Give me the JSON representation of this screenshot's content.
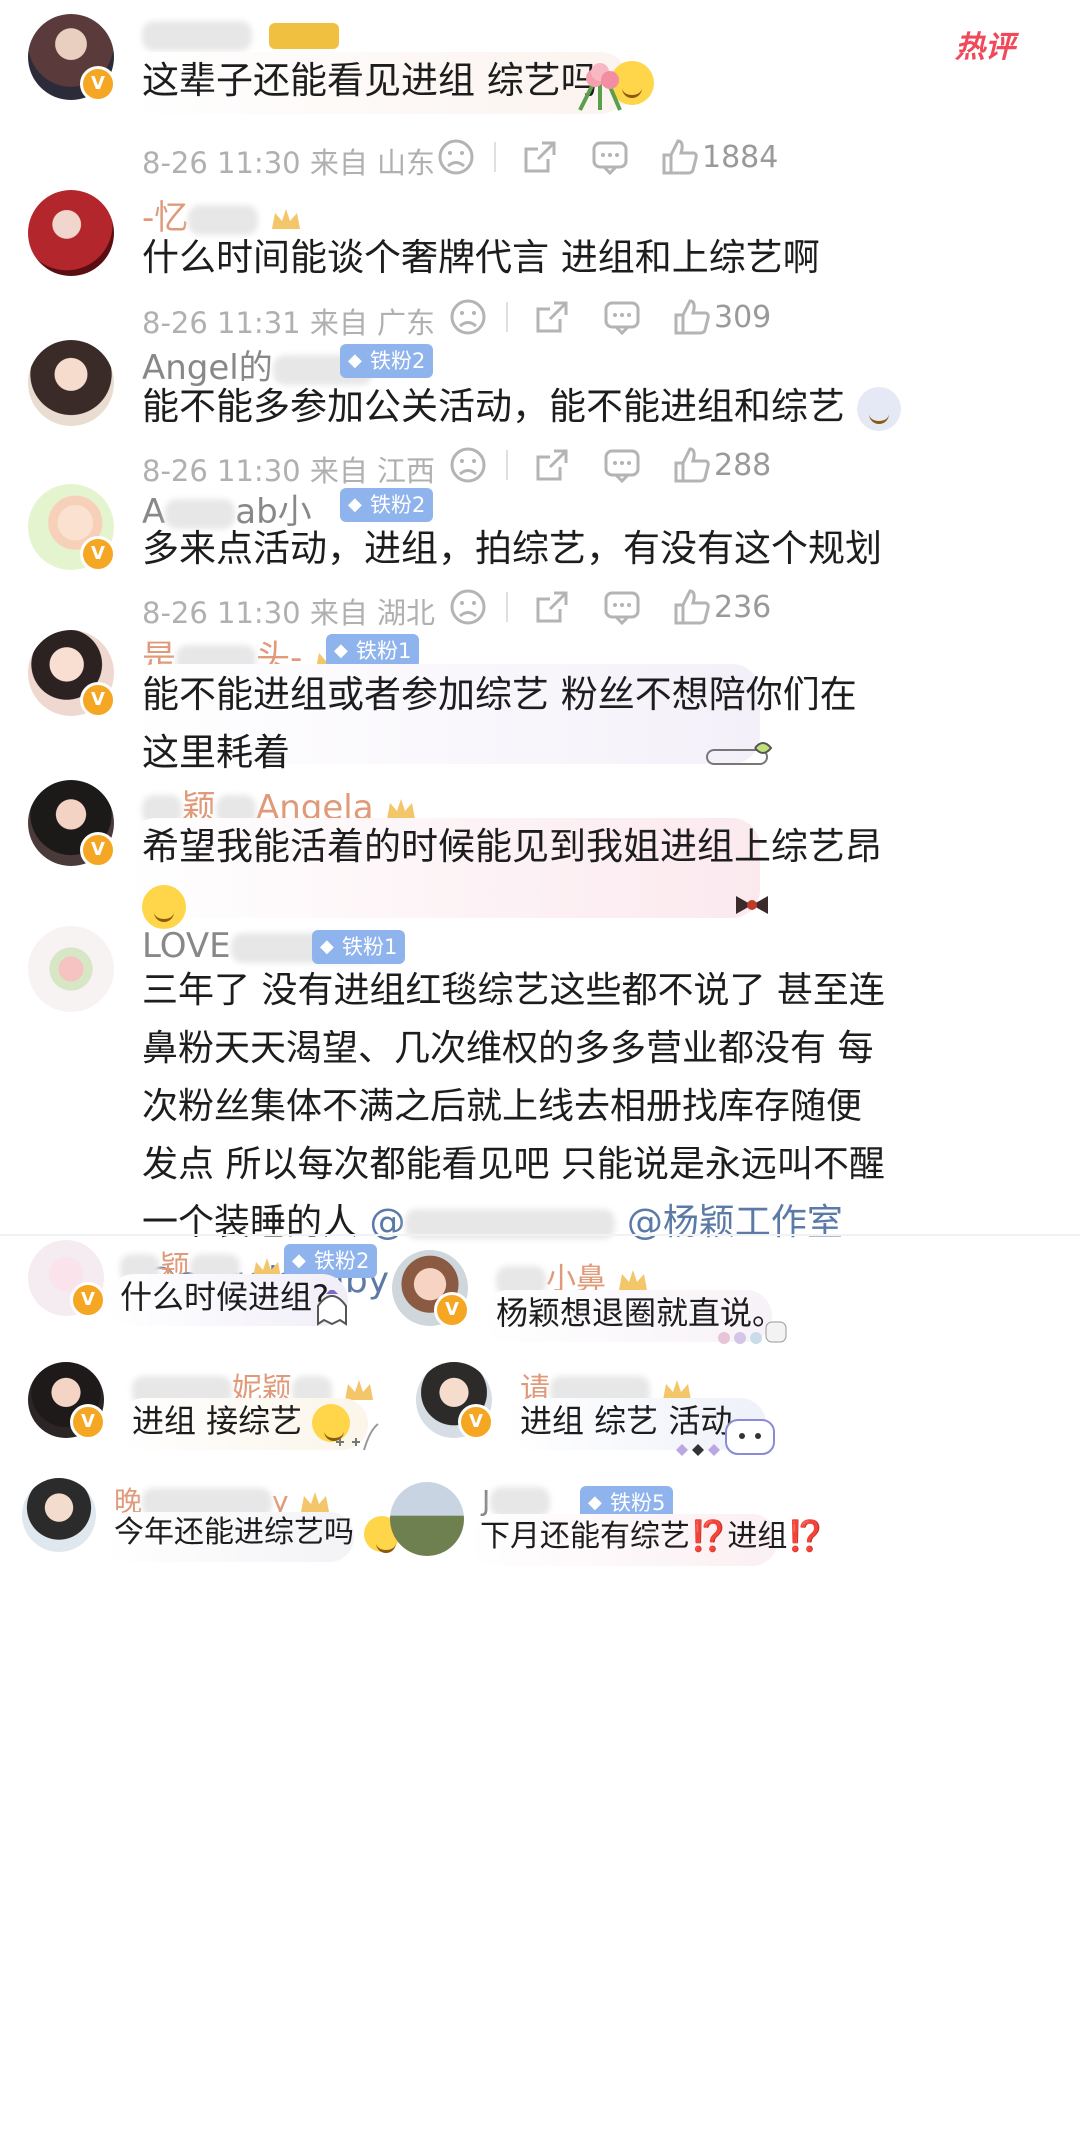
{
  "hot_label": "热评",
  "comments": [
    {
      "name_suffix": "",
      "text": "这辈子还能看见进组 综艺吗",
      "meta": "8-26 11:30 来自 山东",
      "likes": "1884",
      "avatar_color": "#6b4a4a"
    },
    {
      "name_prefix": "-忆",
      "text": "什么时间能谈个奢牌代言 进组和上综艺啊",
      "meta": "8-26 11:31 来自 广东",
      "likes": "309",
      "avatar_color": "#a8242a"
    },
    {
      "name_prefix": "Angel的",
      "badge": "铁粉2",
      "text": "能不能多参加公关活动，能不能进组和综艺",
      "meta": "8-26 11:30 来自 江西",
      "likes": "288",
      "avatar_color": "#c9a48a"
    },
    {
      "name_prefix": "A",
      "name_mid": "ab小",
      "badge": "铁粉2",
      "text": "多来点活动，进组，拍综艺，有没有这个规划",
      "meta": "8-26 11:30 来自 湖北",
      "likes": "236",
      "avatar_color": "#dff1c2"
    },
    {
      "name_prefix": "是",
      "name_suffix": "头-",
      "badge": "铁粉1",
      "text_lines": [
        "能不能进组或者参加综艺 粉丝不想陪你们在",
        "这里耗着"
      ],
      "avatar_color": "#e8c8bc"
    },
    {
      "name_mid": "颖",
      "name_suffix": "Angela",
      "text_lines": [
        "希望我能活着的时候能见到我姐进组上综艺昂"
      ],
      "avatar_color": "#2e2a2a"
    },
    {
      "name_prefix": "LOVE",
      "badge": "铁粉1",
      "text_lines": [
        "三年了 没有进组红毯综艺这些都不说了 甚至连",
        "鼻粉天天渴望、几次维权的多多营业都没有 每",
        "次粉丝集体不满之后就上线去相册找库存随便",
        "发点 所以每次都能看见吧 只能说是永远叫不醒"
      ],
      "line5": "一个装睡的人",
      "mention1": "@杨颖工作室",
      "mention2": "@angelababy",
      "avatar_color": "#f3e6e6"
    }
  ],
  "grid": [
    {
      "name_mid": "颖",
      "badge": "铁粉2",
      "text": "什么时候进组?",
      "avatar_color": "#f4eef2"
    },
    {
      "name_suffix": "小鼻",
      "text": "杨颖想退圈就直说。",
      "avatar_color": "#d9b59c"
    },
    {
      "name_mid": "妮颖",
      "text": "进组 接综艺",
      "avatar_color": "#3a2f2f"
    },
    {
      "name_prefix": "请",
      "text": "进组 综艺 活动",
      "avatar_color": "#cfd8e6"
    },
    {
      "name_prefix": "晚",
      "name_suffix": "y",
      "text": "今年还能进综艺吗",
      "avatar_color": "#d7e0ea"
    },
    {
      "name_prefix": "J",
      "badge": "铁粉5",
      "text": "下月还能有综艺⁉️进组⁉️",
      "avatar_color": "#7d8a66"
    }
  ]
}
